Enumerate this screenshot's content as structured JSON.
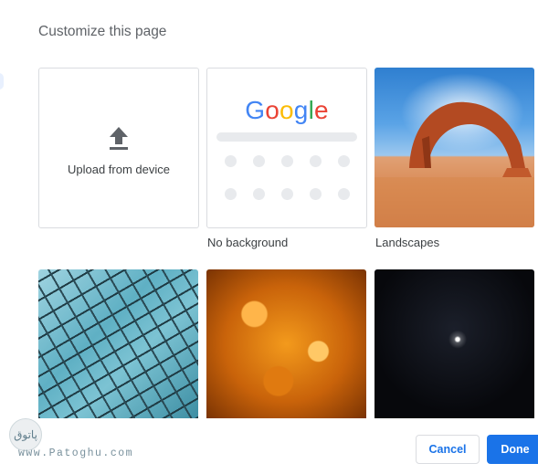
{
  "dialog": {
    "title": "Customize this page"
  },
  "tiles": {
    "upload": {
      "label": "Upload from device",
      "icon": "upload-icon"
    },
    "no_background": {
      "logo_letters": [
        "G",
        "o",
        "o",
        "g",
        "l",
        "e"
      ],
      "caption": "No background"
    },
    "landscapes": {
      "caption": "Landscapes"
    }
  },
  "footer": {
    "watermark_logo": "پاتوق",
    "watermark_url": "www.Patoghu.com",
    "cancel_label": "Cancel",
    "done_label": "Done"
  },
  "colors": {
    "accent": "#1a73e8",
    "google_blue": "#4285f4",
    "google_red": "#ea4335",
    "google_yellow": "#fbbc05",
    "google_green": "#34a853"
  }
}
